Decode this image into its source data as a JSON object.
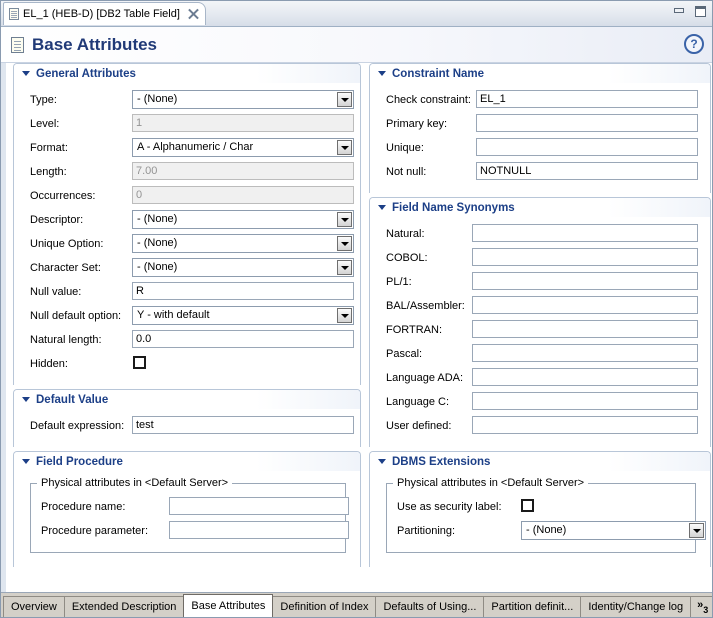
{
  "window": {
    "editor_tab": {
      "title": "EL_1 (HEB-D)  [DB2 Table Field]",
      "icon": "document-icon",
      "close_icon": "close-icon"
    },
    "minimize_label": "–",
    "maximize_label": "□"
  },
  "header": {
    "title": "Base Attributes",
    "icon": "document-icon",
    "help_label": "?",
    "title_color": "#213a77"
  },
  "general_attributes": {
    "title": "General Attributes",
    "rows": [
      {
        "label": "Type:",
        "kind": "combo",
        "value": "- (None)"
      },
      {
        "label": "Level:",
        "kind": "text-readonly",
        "value": "1"
      },
      {
        "label": "Format:",
        "kind": "combo",
        "value": "A - Alphanumeric / Char"
      },
      {
        "label": "Length:",
        "kind": "text-readonly",
        "value": "7.00"
      },
      {
        "label": "Occurrences:",
        "kind": "text-readonly",
        "value": "0"
      },
      {
        "label": "Descriptor:",
        "kind": "combo",
        "value": "- (None)"
      },
      {
        "label": "Unique Option:",
        "kind": "combo",
        "value": "- (None)"
      },
      {
        "label": "Character Set:",
        "kind": "combo",
        "value": "- (None)"
      },
      {
        "label": "Null value:",
        "kind": "text",
        "value": "R"
      },
      {
        "label": "Null default option:",
        "kind": "combo",
        "value": "Y - with default"
      },
      {
        "label": "Natural length:",
        "kind": "text",
        "value": "0.0"
      },
      {
        "label": "Hidden:",
        "kind": "checkbox",
        "checked": false
      }
    ]
  },
  "default_value": {
    "title": "Default Value",
    "rows": [
      {
        "label": "Default expression:",
        "kind": "text",
        "value": "test"
      }
    ]
  },
  "field_procedure": {
    "title": "Field Procedure",
    "group_legend": "Physical attributes in <Default Server>",
    "rows": [
      {
        "label": "Procedure name:",
        "kind": "text",
        "value": ""
      },
      {
        "label": "Procedure parameter:",
        "kind": "text",
        "value": ""
      }
    ]
  },
  "constraint_name": {
    "title": "Constraint Name",
    "rows": [
      {
        "label": "Check constraint:",
        "kind": "text",
        "value": "EL_1"
      },
      {
        "label": "Primary key:",
        "kind": "text",
        "value": ""
      },
      {
        "label": "Unique:",
        "kind": "text",
        "value": ""
      },
      {
        "label": "Not null:",
        "kind": "text",
        "value": "NOTNULL"
      }
    ]
  },
  "field_name_synonyms": {
    "title": "Field Name Synonyms",
    "rows": [
      {
        "label": "Natural:",
        "kind": "text",
        "value": ""
      },
      {
        "label": "COBOL:",
        "kind": "text",
        "value": ""
      },
      {
        "label": "PL/1:",
        "kind": "text",
        "value": ""
      },
      {
        "label": "BAL/Assembler:",
        "kind": "text",
        "value": ""
      },
      {
        "label": "FORTRAN:",
        "kind": "text",
        "value": ""
      },
      {
        "label": "Pascal:",
        "kind": "text",
        "value": ""
      },
      {
        "label": "Language ADA:",
        "kind": "text",
        "value": ""
      },
      {
        "label": "Language C:",
        "kind": "text",
        "value": ""
      },
      {
        "label": "User defined:",
        "kind": "text",
        "value": ""
      }
    ]
  },
  "dbms_extensions": {
    "title": "DBMS Extensions",
    "group_legend": "Physical attributes in <Default Server>",
    "rows": [
      {
        "label": "Use as security label:",
        "kind": "checkbox",
        "checked": false
      },
      {
        "label": "Partitioning:",
        "kind": "combo",
        "value": "- (None)"
      }
    ]
  },
  "bottom_tabs": {
    "items": [
      {
        "label": "Overview",
        "active": false
      },
      {
        "label": "Extended Description",
        "active": false
      },
      {
        "label": "Base Attributes",
        "active": true
      },
      {
        "label": "Definition of Index",
        "active": false
      },
      {
        "label": "Defaults of Using...",
        "active": false
      },
      {
        "label": "Partition definit...",
        "active": false
      },
      {
        "label": "Identity/Change log",
        "active": false
      }
    ],
    "overflow": {
      "chevrons": "»",
      "count": "3"
    }
  }
}
